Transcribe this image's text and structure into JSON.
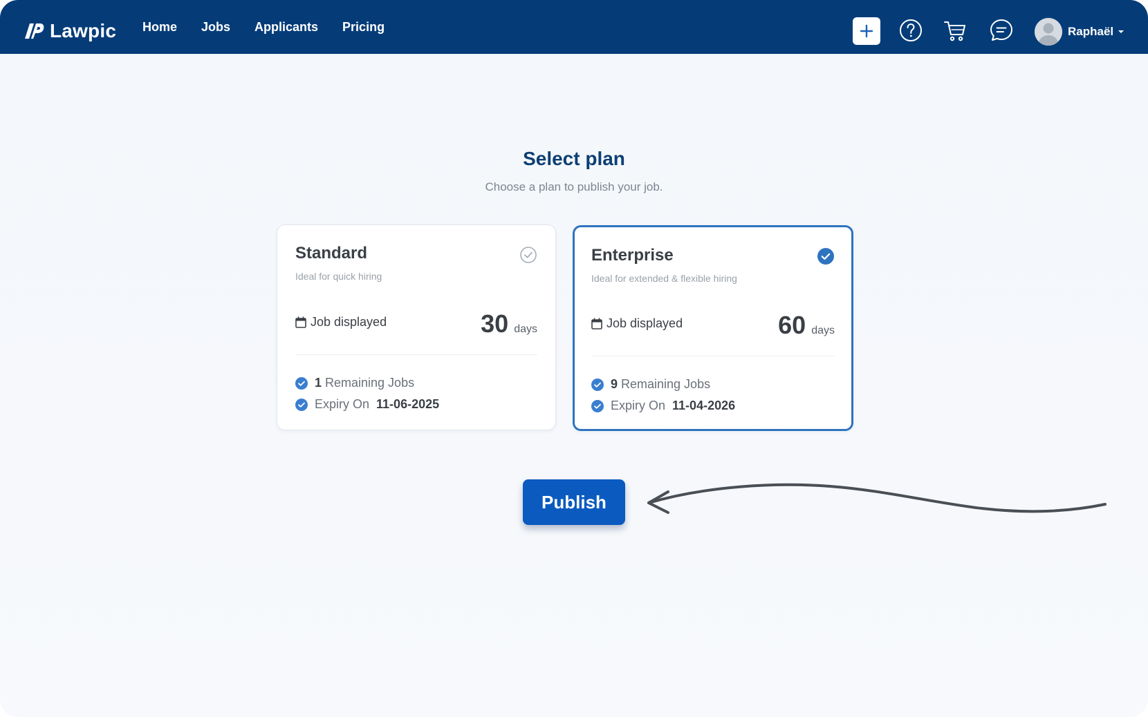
{
  "app": {
    "brand": "Lawpic",
    "nav": [
      {
        "label": "Home"
      },
      {
        "label": "Jobs"
      },
      {
        "label": "Applicants"
      },
      {
        "label": "Pricing"
      }
    ],
    "icons": {
      "add": "plus-icon",
      "help": "help-icon",
      "cart": "cart-icon",
      "messages": "chat-icon"
    },
    "user": {
      "name": "Raphaël"
    }
  },
  "page": {
    "title": "Select plan",
    "subtitle": "Choose a plan to publish your job."
  },
  "plans": [
    {
      "name": "Standard",
      "description": "Ideal for quick hiring",
      "job_label": "Job displayed",
      "days": "30",
      "days_unit": "days",
      "remaining_count": "1",
      "remaining_label": "Remaining Jobs",
      "expiry_label": "Expiry On",
      "expiry_date": "11-06-2025",
      "selected": false
    },
    {
      "name": "Enterprise",
      "description": "Ideal for extended & flexible hiring",
      "job_label": "Job displayed",
      "days": "60",
      "days_unit": "days",
      "remaining_count": "9",
      "remaining_label": "Remaining Jobs",
      "expiry_label": "Expiry On",
      "expiry_date": "11-04-2026",
      "selected": true
    }
  ],
  "actions": {
    "publish_label": "Publish"
  },
  "colors": {
    "nav_bg": "#053c78",
    "accent": "#2e73c0",
    "primary_button": "#0a5ac0",
    "heading": "#0d3f74"
  }
}
